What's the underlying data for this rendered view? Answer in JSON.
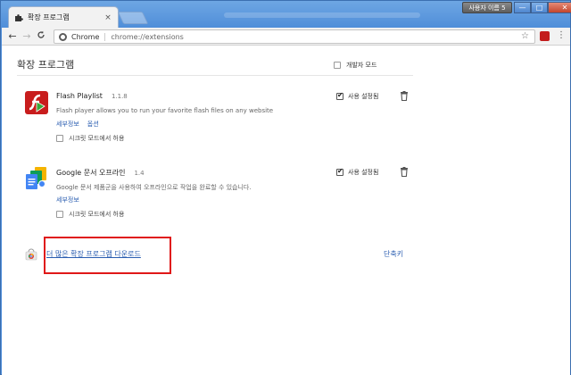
{
  "window": {
    "tab_title": "확장 프로그램",
    "tab_close": "×",
    "user_badge": "사용자 이름 5",
    "minimize": "—",
    "maximize": "□",
    "close": "✕"
  },
  "toolbar": {
    "back": "←",
    "forward": "→",
    "reload": "C",
    "chip_label": "Chrome",
    "url": "chrome://extensions",
    "star": "☆",
    "menu": "⋮"
  },
  "page": {
    "title": "확장 프로그램",
    "developer_mode_label": "개발자 모드",
    "developer_mode_checked": false
  },
  "extensions": [
    {
      "name": "Flash Playlist",
      "version": "1.1.8",
      "description": "Flash player allows you to run your favorite flash files on any website",
      "links": [
        "세부정보",
        "옵션"
      ],
      "enabled_label": "사용 설정됨",
      "enabled": true,
      "incognito_label": "시크릿 모드에서 허용",
      "incognito": false,
      "icon": "flash-icon"
    },
    {
      "name": "Google 문서 오프라인",
      "version": "1.4",
      "description": "Google 문서 제품군을 사용하여 오프라인으로 작업을 완료할 수 있습니다.",
      "links": [
        "세부정보"
      ],
      "enabled_label": "사용 설정됨",
      "enabled": true,
      "incognito_label": "시크릿 모드에서 허용",
      "incognito": false,
      "icon": "google-docs-icon"
    }
  ],
  "footer": {
    "more_extensions_link": "더 많은 확장 프로그램 다운로드",
    "shortcuts_link": "단축키"
  },
  "colors": {
    "link": "#2a5db0",
    "highlight_box": "#e01818",
    "window_frame": "#4f8ed9"
  }
}
